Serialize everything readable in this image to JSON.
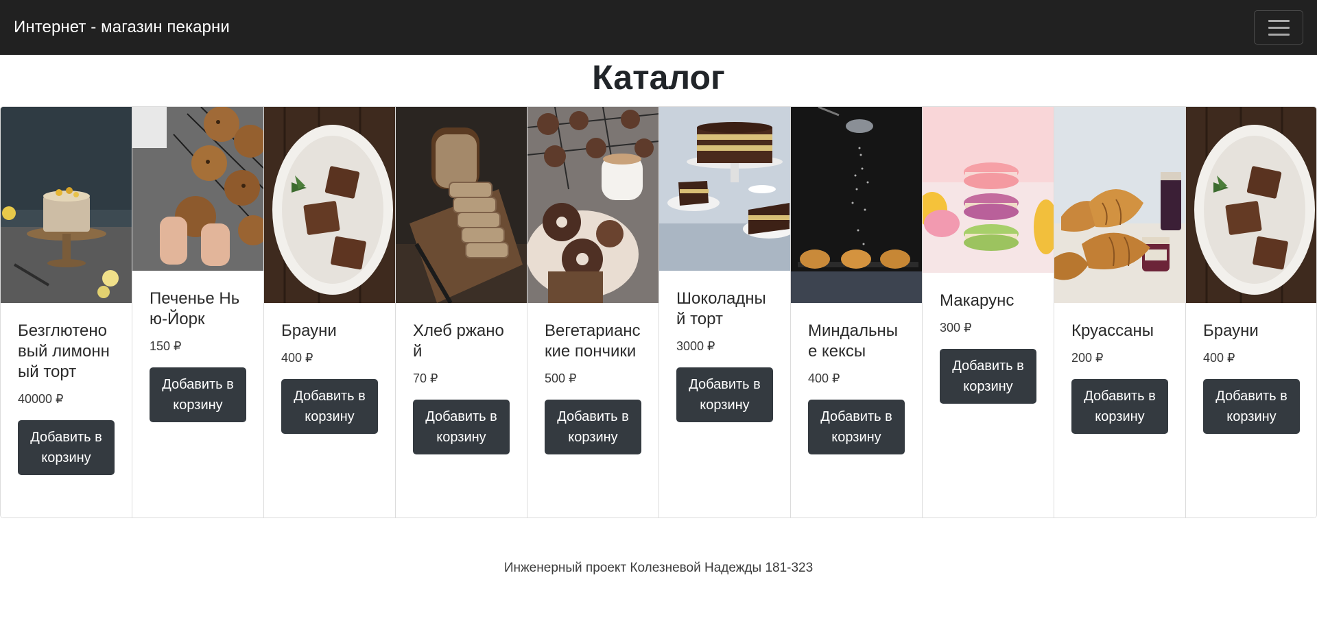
{
  "navbar": {
    "brand": "Интернет - магазин пекарни",
    "toggler_icon": "hamburger-icon"
  },
  "catalog": {
    "title": "Каталог",
    "add_to_cart_label": "Добавить в корзину",
    "products": [
      {
        "name": "Безглютеновый лимонный торт",
        "price": "40000 ₽",
        "image": "lemon-cake-photo"
      },
      {
        "name": "Печенье Нью-Йорк",
        "price": "150 ₽",
        "image": "cookies-photo"
      },
      {
        "name": "Брауни",
        "price": "400 ₽",
        "image": "brownie-photo"
      },
      {
        "name": "Хлеб ржаной",
        "price": "70 ₽",
        "image": "rye-bread-photo"
      },
      {
        "name": "Вегетарианские пончики",
        "price": "500 ₽",
        "image": "donuts-photo"
      },
      {
        "name": "Шоколадный торт",
        "price": "3000 ₽",
        "image": "chocolate-cake-photo"
      },
      {
        "name": "Миндальные кексы",
        "price": "400 ₽",
        "image": "almond-muffins-photo"
      },
      {
        "name": "Макарунс",
        "price": "300 ₽",
        "image": "macarons-photo"
      },
      {
        "name": "Круассаны",
        "price": "200 ₽",
        "image": "croissants-photo"
      },
      {
        "name": "Брауни",
        "price": "400 ₽",
        "image": "brownie-photo"
      }
    ]
  },
  "footer": {
    "text": "Инженерный проект Колезневой Надежды 181-323"
  }
}
